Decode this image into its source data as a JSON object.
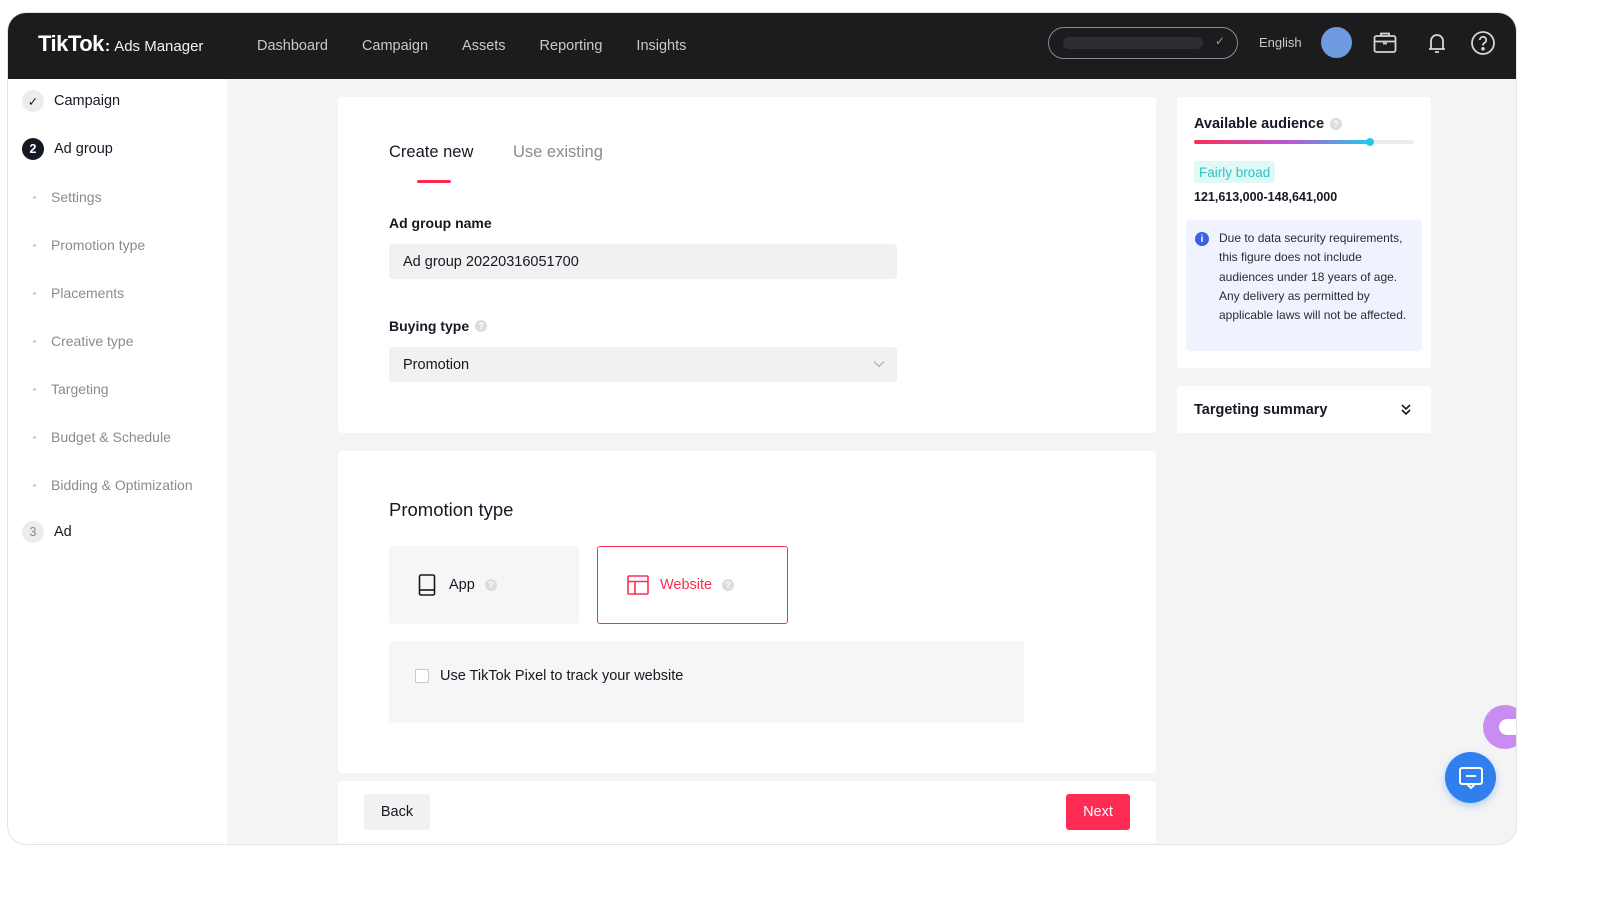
{
  "header": {
    "brand": "TikTok",
    "brand_dot": ":",
    "product": "Ads Manager",
    "nav": [
      "Dashboard",
      "Campaign",
      "Assets",
      "Reporting",
      "Insights"
    ],
    "language": "English"
  },
  "sidebar": {
    "steps": [
      {
        "number": "✓",
        "label": "Campaign",
        "state": "done"
      },
      {
        "number": "2",
        "label": "Ad group",
        "state": "active"
      },
      {
        "number": "3",
        "label": "Ad",
        "state": "todo"
      }
    ],
    "sub_items": [
      "Settings",
      "Promotion type",
      "Placements",
      "Creative type",
      "Targeting",
      "Budget & Schedule",
      "Bidding & Optimization"
    ]
  },
  "form": {
    "tabs": [
      "Create new",
      "Use existing"
    ],
    "active_tab": 0,
    "ad_group_name_label": "Ad group name",
    "ad_group_name_value": "Ad group 20220316051700",
    "buying_type_label": "Buying type",
    "buying_type_value": "Promotion"
  },
  "promotion": {
    "title": "Promotion type",
    "options": [
      {
        "label": "App",
        "icon": "mobile-icon",
        "selected": false
      },
      {
        "label": "Website",
        "icon": "website-icon",
        "selected": true
      }
    ],
    "pixel_label": "Use TikTok Pixel to track your website",
    "pixel_checked": false
  },
  "footer": {
    "back_label": "Back",
    "next_label": "Next"
  },
  "audience": {
    "title": "Available audience",
    "level_fraction": 0.8,
    "badge": "Fairly broad",
    "range": "121,613,000-148,641,000",
    "info_icon": "i",
    "info_text": "Due to data security requirements, this figure does not include audiences under 18 years of age. Any delivery as permitted by applicable laws will not be affected."
  },
  "targeting_summary": {
    "label": "Targeting summary"
  },
  "colors": {
    "accent": "#fe2c55",
    "topbar": "#1c1c1f",
    "info": "#3a61e0",
    "chat": "#2f80ed"
  }
}
